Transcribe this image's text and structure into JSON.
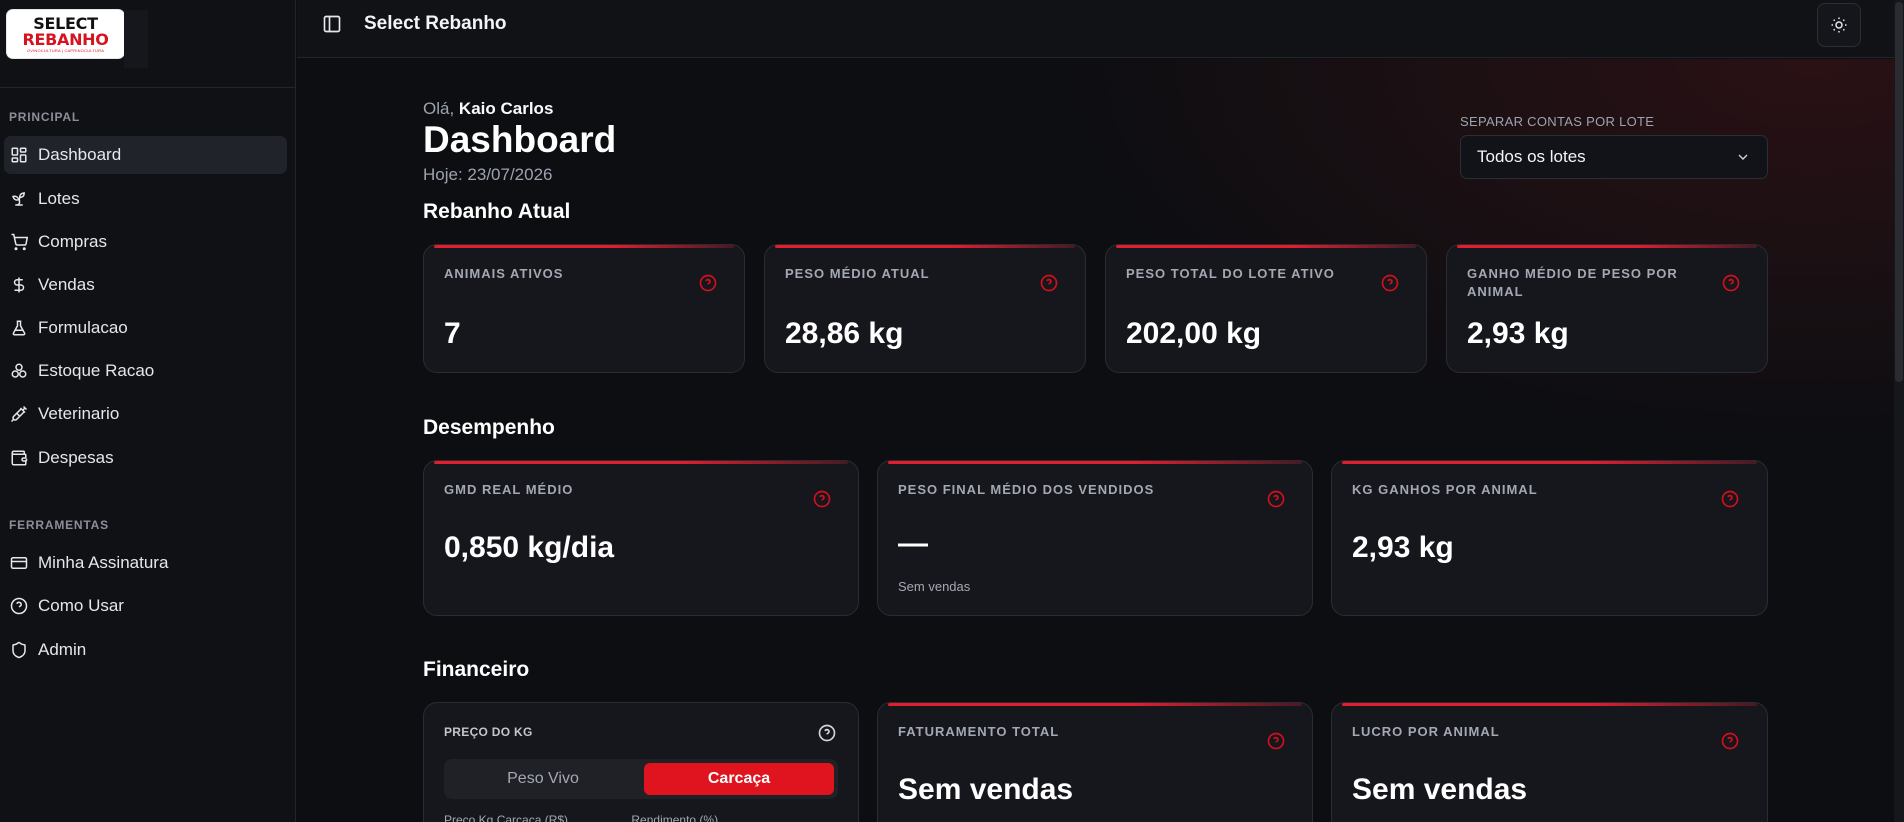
{
  "logo": {
    "line1": "SELECT",
    "line2": "REBANHO",
    "tagline": "OVINOCULTURA | CAPRINOCULTURA"
  },
  "sidebar": {
    "principal_label": "PRINCIPAL",
    "principal_items": [
      {
        "label": "Dashboard",
        "icon": "dashboard-grid-icon"
      },
      {
        "label": "Lotes",
        "icon": "sprout-icon"
      },
      {
        "label": "Compras",
        "icon": "cart-icon"
      },
      {
        "label": "Vendas",
        "icon": "dollar-icon"
      },
      {
        "label": "Formulacao",
        "icon": "flask-icon"
      },
      {
        "label": "Estoque Racao",
        "icon": "boxes-icon"
      },
      {
        "label": "Veterinario",
        "icon": "syringe-icon"
      },
      {
        "label": "Despesas",
        "icon": "wallet-icon"
      }
    ],
    "ferramentas_label": "FERRAMENTAS",
    "ferramentas_items": [
      {
        "label": "Minha Assinatura",
        "icon": "credit-card-icon"
      },
      {
        "label": "Como Usar",
        "icon": "help-circle-icon"
      },
      {
        "label": "Admin",
        "icon": "shield-icon"
      }
    ]
  },
  "topbar": {
    "title": "Select Rebanho"
  },
  "header": {
    "greeting_prefix": "Olá,",
    "user_name": "Kaio Carlos",
    "title": "Dashboard",
    "today": "Hoje: 23/07/2026",
    "lot_label": "SEPARAR CONTAS POR LOTE",
    "lot_selected": "Todos os lotes"
  },
  "sections": {
    "rebanho": "Rebanho Atual",
    "desempenho": "Desempenho",
    "financeiro": "Financeiro"
  },
  "rebanho_cards": [
    {
      "label": "ANIMAIS ATIVOS",
      "value": "7"
    },
    {
      "label": "PESO MÉDIO ATUAL",
      "value": "28,86 kg"
    },
    {
      "label": "PESO TOTAL DO LOTE ATIVO",
      "value": "202,00 kg"
    },
    {
      "label": "GANHO MÉDIO DE PESO POR ANIMAL",
      "value": "2,93 kg"
    }
  ],
  "desempenho_cards": [
    {
      "label": "GMD REAL MÉDIO",
      "value": "0,850 kg/dia"
    },
    {
      "label": "PESO FINAL MÉDIO DOS VENDIDOS",
      "value": "—",
      "sub": "Sem vendas"
    },
    {
      "label": "KG GANHOS POR ANIMAL",
      "value": "2,93 kg"
    }
  ],
  "financeiro": {
    "preco_label": "PREÇO DO KG",
    "seg_off": "Peso Vivo",
    "seg_on": "Carcaça",
    "tiny_left": "Preço Kg Carcaça (R$)",
    "tiny_right": "Rendimento (%)",
    "faturamento_label": "FATURAMENTO TOTAL",
    "faturamento_value": "Sem vendas",
    "lucro_label": "LUCRO POR ANIMAL",
    "lucro_value": "Sem vendas"
  },
  "colors": {
    "accent": "#e0141e",
    "bg": "#0d0e12",
    "card": "#16171d"
  }
}
